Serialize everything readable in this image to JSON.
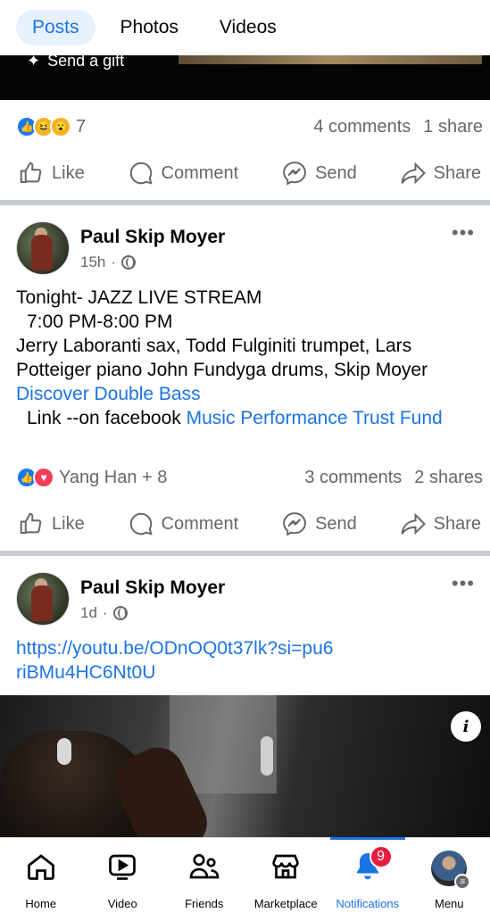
{
  "tabs": [
    {
      "label": "Posts",
      "active": true
    },
    {
      "label": "Photos",
      "active": false
    },
    {
      "label": "Videos",
      "active": false
    }
  ],
  "top_video": {
    "gift_label": "Send a gift"
  },
  "post1_summary": {
    "reaction_count": "7",
    "comments": "4 comments",
    "shares": "1 share"
  },
  "actions": {
    "like": "Like",
    "comment": "Comment",
    "send": "Send",
    "share": "Share"
  },
  "post2": {
    "author": "Paul Skip Moyer",
    "time": "15h",
    "line1": "Tonight- JAZZ LIVE STREAM",
    "line2": "7:00 PM-8:00 PM",
    "line3": "Jerry Laboranti sax, Todd Fulginiti trumpet, Lars Potteiger piano John Fundyga drums, Skip Moyer ",
    "link1": "Discover Double Bass",
    "line4": "Link --on facebook ",
    "link2": "Music Performance Trust Fund",
    "reactions_label": "Yang Han + 8",
    "comments": "3 comments",
    "shares": "2 shares"
  },
  "post3": {
    "author": "Paul Skip Moyer",
    "time": "1d",
    "link": "https://youtu.be/ODnOQ0t37lk?si=pu6riBMu4HC6Nt0U"
  },
  "bottom_nav": {
    "home": "Home",
    "video": "Video",
    "friends": "Friends",
    "marketplace": "Marketplace",
    "notifications": "Notifications",
    "notifications_badge": "9",
    "menu": "Menu"
  },
  "colors": {
    "accent": "#1b74e4",
    "badge": "#e41e3f",
    "divider": "#c9ccd1"
  }
}
